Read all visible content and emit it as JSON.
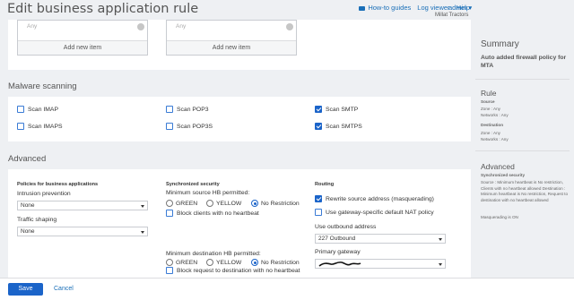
{
  "header": {
    "title": "Edit business application rule",
    "links": {
      "how_to": "How-to guides",
      "log_viewer": "Log viewer",
      "help": "Help"
    },
    "user": "admin",
    "organization": "Millat Tractors"
  },
  "top_section": {
    "left_box": {
      "placeholder": "Any",
      "add_label": "Add new item"
    },
    "right_box": {
      "placeholder": "Any",
      "add_label": "Add new item"
    }
  },
  "malware": {
    "heading": "Malware scanning",
    "options": [
      {
        "label": "Scan IMAP",
        "checked": false
      },
      {
        "label": "Scan POP3",
        "checked": false
      },
      {
        "label": "Scan SMTP",
        "checked": true
      },
      {
        "label": "Scan IMAPS",
        "checked": false
      },
      {
        "label": "Scan POP3S",
        "checked": false
      },
      {
        "label": "Scan SMTPS",
        "checked": true
      }
    ]
  },
  "advanced": {
    "heading": "Advanced",
    "policies": {
      "heading": "Policies for business applications",
      "intrusion_label": "Intrusion prevention",
      "intrusion_value": "None",
      "traffic_label": "Traffic shaping",
      "traffic_value": "None"
    },
    "security": {
      "heading": "Synchronized security",
      "min_source_label": "Minimum source HB permitted:",
      "min_dest_label": "Minimum destination HB permitted:",
      "radio_options": [
        "GREEN",
        "YELLOW",
        "No Restriction"
      ],
      "selected": "No Restriction",
      "block_clients_label": "Block clients with no heartbeat",
      "block_clients_checked": false,
      "block_request_label": "Block request to destination with no heartbeat",
      "block_request_checked": false
    },
    "routing": {
      "heading": "Routing",
      "rewrite_label": "Rewrite source address (masquerading)",
      "rewrite_checked": true,
      "gateway_nat_label": "Use gateway-specific default NAT policy",
      "gateway_nat_checked": false,
      "outbound_label": "Use outbound address",
      "outbound_value": "227 Outbound",
      "primary_gateway_label": "Primary gateway"
    }
  },
  "summary": {
    "heading": "Summary",
    "description": "Auto added firewall policy for MTA",
    "rule_heading": "Rule",
    "source_label": "Source",
    "source_lines": [
      "Zone : Any",
      "Networks : Any"
    ],
    "destination_label": "Destination",
    "destination_lines": [
      "Zone : Any",
      "Networks : Any"
    ],
    "advanced_heading": "Advanced",
    "sync_label": "Synchronized security",
    "sync_text": "Source : Minimum heartbeat is No restriction, Clients with no heartbeat allowed Destination : Minimum heartbeat is No restriction, Request to destination with no heartbeat allowed",
    "masquerading": "Masquerading is ON"
  },
  "footer": {
    "save": "Save",
    "cancel": "Cancel"
  },
  "colors": {
    "accent": "#1b64c9",
    "link": "#1a6fb8",
    "background": "#eef0f3"
  }
}
